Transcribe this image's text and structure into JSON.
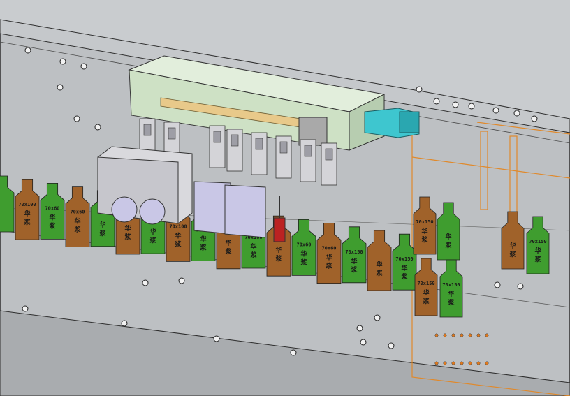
{
  "viewport": {
    "title": "",
    "background": "#c9cccf",
    "plate_color": "#b8bbbe",
    "edge_color": "#3a3a3a"
  },
  "colors": {
    "bag_brown": "#a0622a",
    "bag_green": "#3f9d2f",
    "housing_glass": "#cfe3c6",
    "motor_cyan": "#3ec6cf",
    "orange_outline": "#e0892b",
    "block_lavender": "#c9c7e6"
  },
  "bags": [
    {
      "color": "green",
      "size": "",
      "text": ""
    },
    {
      "color": "brown",
      "size": "70x100",
      "text": "华浆"
    },
    {
      "color": "green",
      "size": "70x60",
      "text": "华浆"
    },
    {
      "color": "brown",
      "size": "70x60",
      "text": "华浆"
    },
    {
      "color": "green",
      "size": "",
      "text": "华浆"
    },
    {
      "color": "brown",
      "size": "",
      "text": "华浆"
    },
    {
      "color": "green",
      "size": "",
      "text": "华浆"
    },
    {
      "color": "brown",
      "size": "70x100",
      "text": "华浆"
    },
    {
      "color": "green",
      "size": "70x60",
      "text": "华浆"
    },
    {
      "color": "brown",
      "size": "",
      "text": "华浆"
    },
    {
      "color": "green",
      "size": "70x100",
      "text": "华浆"
    },
    {
      "color": "brown",
      "size": "",
      "text": "华浆"
    },
    {
      "color": "green",
      "size": "70x60",
      "text": "华浆"
    },
    {
      "color": "brown",
      "size": "70x60",
      "text": "华浆"
    },
    {
      "color": "green",
      "size": "70x150",
      "text": "华浆"
    },
    {
      "color": "brown",
      "size": "",
      "text": "华浆"
    },
    {
      "color": "green",
      "size": "70x150",
      "text": "华浆"
    }
  ],
  "bags_right": [
    {
      "color": "brown",
      "size": "70x150",
      "text": "华浆"
    },
    {
      "color": "green",
      "size": "",
      "text": "华浆"
    },
    {
      "color": "brown",
      "size": "70x150",
      "text": "华浆"
    },
    {
      "color": "green",
      "size": "70x150",
      "text": "华浆"
    },
    {
      "color": "brown",
      "size": "",
      "text": "华浆"
    },
    {
      "color": "green",
      "size": "70x150",
      "text": "华浆"
    }
  ]
}
